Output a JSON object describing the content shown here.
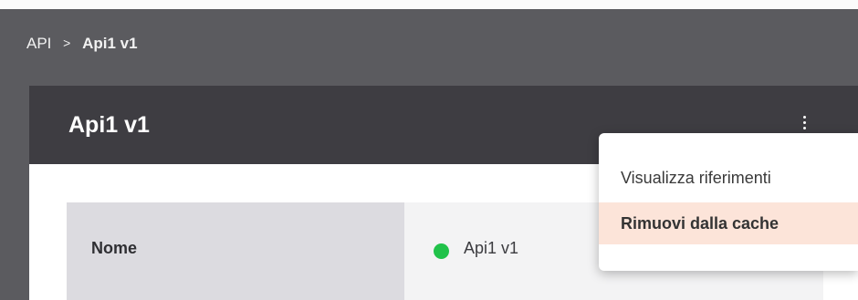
{
  "breadcrumb": {
    "root": "API",
    "separator": ">",
    "current": "Api1 v1"
  },
  "panel": {
    "title": "Api1 v1",
    "menu_icon": "kebab-vertical-icon"
  },
  "details": {
    "rows": [
      {
        "label": "Nome",
        "value": "Api1 v1",
        "status_color": "#21c24a"
      }
    ]
  },
  "menu": {
    "items": [
      {
        "label": "Visualizza riferimenti",
        "state": "normal"
      },
      {
        "label": "Rimuovi dalla cache",
        "state": "highlighted"
      }
    ]
  },
  "colors": {
    "header_bar": "#5b5b5f",
    "panel_header": "#3e3d42",
    "label_cell": "#dcdbe0",
    "value_cell": "#f3f3f4",
    "menu_highlight": "#fce4d9",
    "status_ok": "#21c24a"
  }
}
